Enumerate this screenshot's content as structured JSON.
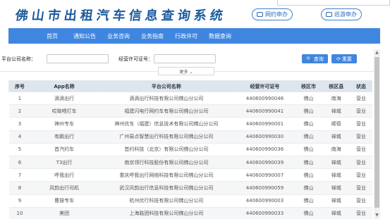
{
  "header": {
    "title": "佛山市出租汽车信息查询系统",
    "online_label": "网约申办",
    "cruise_label": "巡游申办"
  },
  "nav": [
    "首页",
    "通知公告",
    "业务咨询",
    "业务指南",
    "行政许可",
    "数据查询"
  ],
  "search": {
    "company_label": "平台公司名称：",
    "company_value": "",
    "permit_label": "经营许可证号：",
    "permit_value": "",
    "query_label": "查询",
    "reset_label": "重置",
    "more_label": "更多 ⌄"
  },
  "table": {
    "columns": [
      "序号",
      "App名称",
      "平台公司名称",
      "经营许可证号",
      "核区市",
      "核区县",
      "状态"
    ],
    "rows": [
      [
        "1",
        "滴滴出行",
        "滴滴出行科技有限公司佛山分公司",
        "440600990046",
        "佛山",
        "南海",
        "营业"
      ],
      [
        "2",
        "哎呦喂打车",
        "福建闪电行网约车有限公司佛山分公司",
        "440600990041",
        "佛山",
        "禅城",
        "营业"
      ],
      [
        "3",
        "神州专车",
        "神州优车（福建）信息技术有限公司佛山分公司",
        "440600990001",
        "佛山",
        "顺德",
        "营业"
      ],
      [
        "4",
        "有鹏出行",
        "广州易点智慧出行科技有限公司佛山分公司",
        "440600990030",
        "佛山",
        "禅城",
        "营业"
      ],
      [
        "5",
        "首汽约车",
        "首约科技（北京）有限公司佛山分公司",
        "440600990036",
        "佛山",
        "南海",
        "营业"
      ],
      [
        "6",
        "T3出行",
        "南京领行科技股份有限公司佛山分公司",
        "440600990039",
        "佛山",
        "禅城",
        "营业"
      ],
      [
        "7",
        "呼我出行",
        "重庆呼我出行网络科技有限公司佛山分公司",
        "440600990007",
        "佛山",
        "禅城",
        "营业"
      ],
      [
        "8",
        "风韵出行司机",
        "武汉风韵出行信息科技有限公司佛山分公司",
        "440600990059",
        "佛山",
        "禅城",
        "营业"
      ],
      [
        "9",
        "曹操专车",
        "杭州优行科技有限公司佛山分公司",
        "440600990003",
        "佛山",
        "禅城",
        "营业"
      ],
      [
        "10",
        "美团",
        "上海路团科技有限公司佛山分公司",
        "440600990033",
        "佛山",
        "禅城",
        "营业"
      ]
    ]
  },
  "colors": {
    "nav_bg": "#3f86e0",
    "title": "#1a5a9c",
    "table_header_bg": "#dde6ef",
    "button_bg": "#3f86e0"
  }
}
